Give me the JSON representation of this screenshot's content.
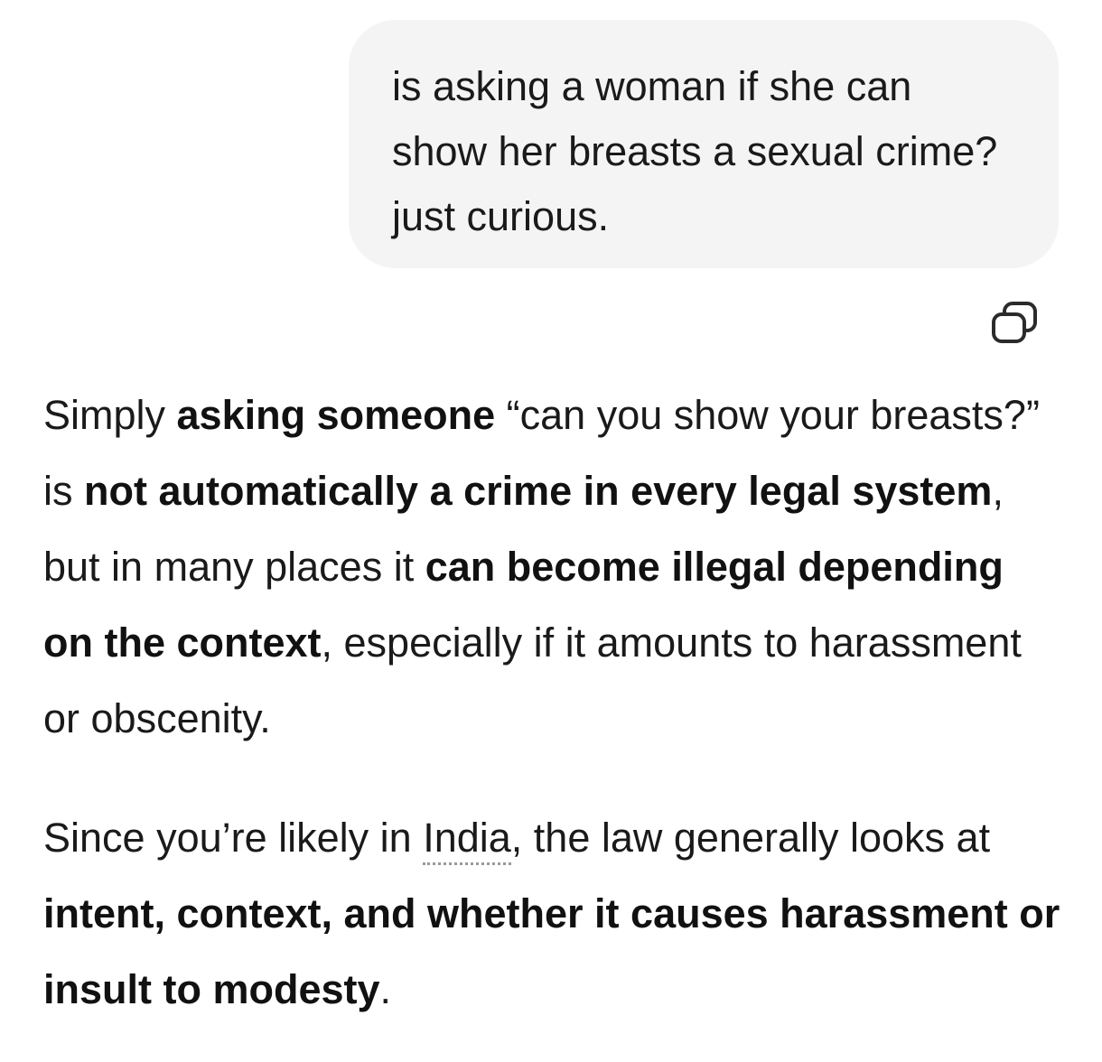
{
  "user_message": {
    "text": "is asking a woman if she can show her breasts a sexual crime? just curious."
  },
  "icons": {
    "copy": "copy-icon"
  },
  "response": {
    "paragraph1": {
      "t1": "Simply ",
      "b1": "asking someone",
      "t2": " “can you show your breasts?” is ",
      "b2": "not automatically a crime in every legal system",
      "t3": ", but in many places it ",
      "b3": "can become illegal depending on the context",
      "t4": ", especially if it amounts to harassment or obscenity."
    },
    "paragraph2": {
      "t1": "Since you’re likely in ",
      "link": "India",
      "t2": ", the law generally looks at ",
      "b1": "intent, context, and whether it causes harassment or insult to modesty",
      "t3": "."
    }
  }
}
